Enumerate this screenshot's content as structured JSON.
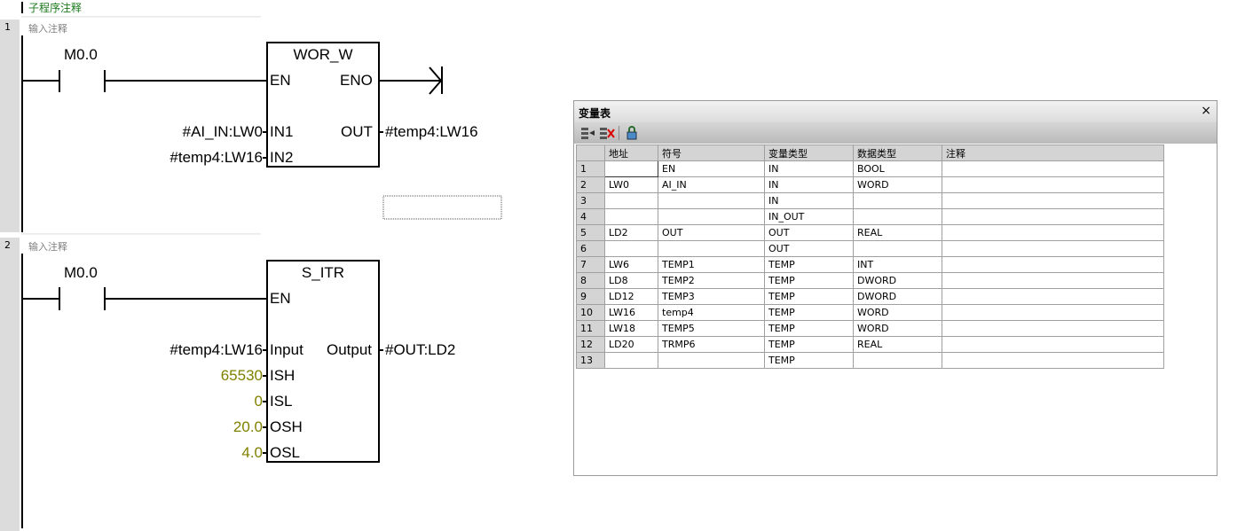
{
  "subroutine_comment": "子程序注释",
  "networks": [
    {
      "number": "1",
      "comment": "输入注释"
    },
    {
      "number": "2",
      "comment": "输入注释"
    }
  ],
  "network1": {
    "contact": "M0.0",
    "block_name": "WOR_W",
    "en": "EN",
    "eno": "ENO",
    "in1_label": "IN1",
    "in2_label": "IN2",
    "out_label": "OUT",
    "in1_operand": "#AI_IN:LW0",
    "in2_operand": "#temp4:LW16",
    "out_operand": "#temp4:LW16"
  },
  "network2": {
    "contact": "M0.0",
    "block_name": "S_ITR",
    "en": "EN",
    "pins": [
      {
        "label": "Input",
        "operand": "#temp4:LW16",
        "const": false
      },
      {
        "label": "ISH",
        "operand": "65530",
        "const": true
      },
      {
        "label": "ISL",
        "operand": "0",
        "const": true
      },
      {
        "label": "OSH",
        "operand": "20.0",
        "const": true
      },
      {
        "label": "OSL",
        "operand": "4.0",
        "const": true
      }
    ],
    "output_label": "Output",
    "output_operand": "#OUT:LD2"
  },
  "var_table": {
    "title": "变量表",
    "close": "×",
    "headers": [
      "地址",
      "符号",
      "变量类型",
      "数据类型",
      "注释"
    ],
    "rows": [
      {
        "n": "1",
        "addr": "",
        "sym": "EN",
        "vtype": "IN",
        "dtype": "BOOL",
        "cmt": ""
      },
      {
        "n": "2",
        "addr": "LW0",
        "sym": "AI_IN",
        "vtype": "IN",
        "dtype": "WORD",
        "cmt": ""
      },
      {
        "n": "3",
        "addr": "",
        "sym": "",
        "vtype": "IN",
        "dtype": "",
        "cmt": ""
      },
      {
        "n": "4",
        "addr": "",
        "sym": "",
        "vtype": "IN_OUT",
        "dtype": "",
        "cmt": ""
      },
      {
        "n": "5",
        "addr": "LD2",
        "sym": "OUT",
        "vtype": "OUT",
        "dtype": "REAL",
        "cmt": ""
      },
      {
        "n": "6",
        "addr": "",
        "sym": "",
        "vtype": "OUT",
        "dtype": "",
        "cmt": ""
      },
      {
        "n": "7",
        "addr": "LW6",
        "sym": "TEMP1",
        "vtype": "TEMP",
        "dtype": "INT",
        "cmt": ""
      },
      {
        "n": "8",
        "addr": "LD8",
        "sym": "TEMP2",
        "vtype": "TEMP",
        "dtype": "DWORD",
        "cmt": ""
      },
      {
        "n": "9",
        "addr": "LD12",
        "sym": "TEMP3",
        "vtype": "TEMP",
        "dtype": "DWORD",
        "cmt": ""
      },
      {
        "n": "10",
        "addr": "LW16",
        "sym": "temp4",
        "vtype": "TEMP",
        "dtype": "WORD",
        "cmt": ""
      },
      {
        "n": "11",
        "addr": "LW18",
        "sym": "TEMP5",
        "vtype": "TEMP",
        "dtype": "WORD",
        "cmt": ""
      },
      {
        "n": "12",
        "addr": "LD20",
        "sym": "TRMP6",
        "vtype": "TEMP",
        "dtype": "REAL",
        "cmt": ""
      },
      {
        "n": "13",
        "addr": "",
        "sym": "",
        "vtype": "TEMP",
        "dtype": "",
        "cmt": ""
      }
    ]
  }
}
